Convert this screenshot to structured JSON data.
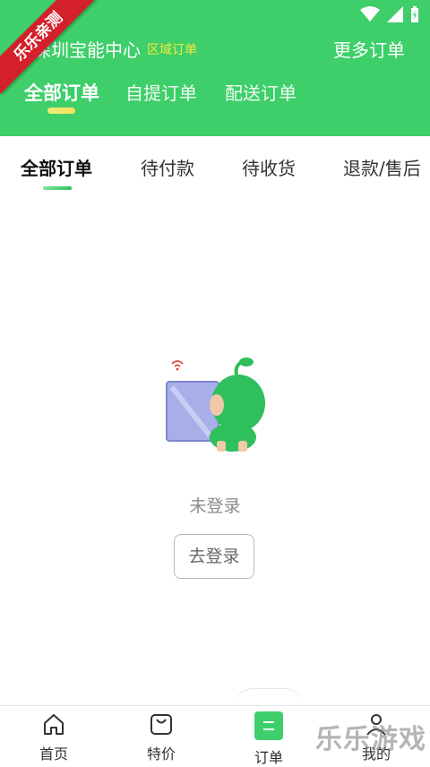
{
  "header": {
    "store_name": "深圳宝能中心",
    "region_tag": "区域订单",
    "more_orders": "更多订单",
    "ribbon": "乐乐亲测",
    "tabs": [
      {
        "label": "全部订单",
        "active": true
      },
      {
        "label": "自提订单",
        "active": false
      },
      {
        "label": "配送订单",
        "active": false
      }
    ]
  },
  "sub_tabs": [
    {
      "label": "全部订单",
      "active": true
    },
    {
      "label": "待付款",
      "active": false
    },
    {
      "label": "待收货",
      "active": false
    },
    {
      "label": "退款/售后",
      "active": false
    }
  ],
  "empty_state": {
    "message": "未登录",
    "login_button": "去登录"
  },
  "bottom_nav": [
    {
      "label": "首页",
      "icon": "home-icon",
      "active": false
    },
    {
      "label": "特价",
      "icon": "bag-icon",
      "active": false
    },
    {
      "label": "订单",
      "icon": "orders-icon",
      "active": true
    },
    {
      "label": "我的",
      "icon": "user-icon",
      "active": false
    }
  ],
  "watermark": "乐乐游戏",
  "colors": {
    "brand_green": "#3ecf6a",
    "region_tag_yellow": "#f5e83a",
    "ribbon_red": "#d4202a"
  }
}
